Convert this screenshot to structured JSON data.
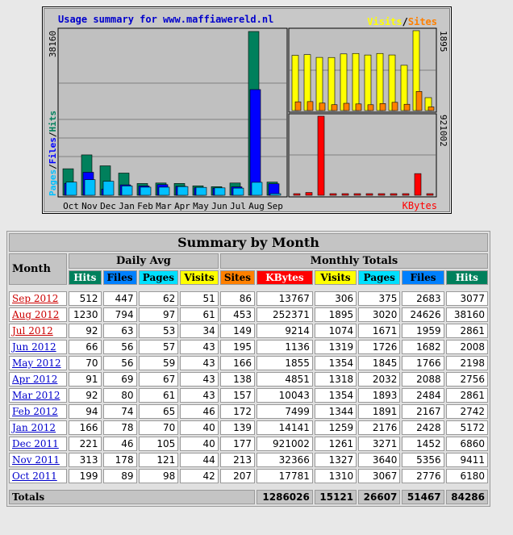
{
  "chart_data": {
    "type": "bar",
    "title": "Usage summary for www.maffiawereld.nl",
    "months": [
      "Oct",
      "Nov",
      "Dec",
      "Jan",
      "Feb",
      "Mar",
      "Apr",
      "May",
      "Jun",
      "Jul",
      "Aug",
      "Sep"
    ],
    "left_panel": {
      "max_label": "38160",
      "legend": [
        "Pages",
        "Files",
        "Hits"
      ],
      "legend_sep": "/",
      "colors": {
        "Hits": "#00805c",
        "Files": "#0000ff",
        "Pages": "#00c0ff"
      },
      "series": {
        "Hits": [
          6180,
          9411,
          6860,
          5172,
          2742,
          2861,
          2756,
          2198,
          2008,
          2861,
          38160,
          3077
        ],
        "Files": [
          2776,
          5356,
          1452,
          2428,
          2167,
          2484,
          2088,
          1766,
          1682,
          1959,
          24626,
          2683
        ],
        "Pages": [
          3067,
          3640,
          3271,
          2176,
          1891,
          1893,
          2032,
          1845,
          1726,
          1671,
          3020,
          375
        ]
      }
    },
    "visits_panel": {
      "max_label": "1895",
      "legend": [
        "Visits",
        "Sites"
      ],
      "legend_sep": "/",
      "colors": {
        "Visits": "#ffff00",
        "Sites": "#ff8000"
      },
      "series": {
        "Visits": [
          1310,
          1327,
          1261,
          1259,
          1344,
          1354,
          1318,
          1354,
          1319,
          1074,
          1895,
          306
        ],
        "Sites": [
          207,
          213,
          177,
          139,
          172,
          157,
          138,
          166,
          195,
          149,
          453,
          86
        ]
      }
    },
    "kbytes_panel": {
      "max_label": "921002",
      "legend": "KBytes",
      "color": "#ff0000",
      "series": {
        "KBytes": [
          17781,
          32366,
          921002,
          14141,
          7499,
          10043,
          4851,
          1855,
          1136,
          9214,
          252371,
          13767
        ]
      }
    }
  },
  "table": {
    "title": "Summary by Month",
    "month_header": "Month",
    "daily_avg_header": "Daily Avg",
    "monthly_totals_header": "Monthly Totals",
    "columns": [
      {
        "label": "Hits",
        "bg": "#00805c"
      },
      {
        "label": "Files",
        "bg": "#0080ff"
      },
      {
        "label": "Pages",
        "bg": "#00e0ff"
      },
      {
        "label": "Visits",
        "bg": "#ffff00"
      },
      {
        "label": "Sites",
        "bg": "#ff8000"
      },
      {
        "label": "KBytes",
        "bg": "#ff0000"
      },
      {
        "label": "Visits",
        "bg": "#ffff00"
      },
      {
        "label": "Pages",
        "bg": "#00e0ff"
      },
      {
        "label": "Files",
        "bg": "#0080ff"
      },
      {
        "label": "Hits",
        "bg": "#00805c"
      }
    ],
    "rows": [
      {
        "month": "Sep 2012",
        "link_color": "red",
        "values": [
          "512",
          "447",
          "62",
          "51",
          "86",
          "13767",
          "306",
          "375",
          "2683",
          "3077"
        ]
      },
      {
        "month": "Aug 2012",
        "link_color": "red",
        "values": [
          "1230",
          "794",
          "97",
          "61",
          "453",
          "252371",
          "1895",
          "3020",
          "24626",
          "38160"
        ]
      },
      {
        "month": "Jul 2012",
        "link_color": "red",
        "values": [
          "92",
          "63",
          "53",
          "34",
          "149",
          "9214",
          "1074",
          "1671",
          "1959",
          "2861"
        ]
      },
      {
        "month": "Jun 2012",
        "link_color": "blue",
        "values": [
          "66",
          "56",
          "57",
          "43",
          "195",
          "1136",
          "1319",
          "1726",
          "1682",
          "2008"
        ]
      },
      {
        "month": "May 2012",
        "link_color": "blue",
        "values": [
          "70",
          "56",
          "59",
          "43",
          "166",
          "1855",
          "1354",
          "1845",
          "1766",
          "2198"
        ]
      },
      {
        "month": "Apr 2012",
        "link_color": "blue",
        "values": [
          "91",
          "69",
          "67",
          "43",
          "138",
          "4851",
          "1318",
          "2032",
          "2088",
          "2756"
        ]
      },
      {
        "month": "Mar 2012",
        "link_color": "blue",
        "values": [
          "92",
          "80",
          "61",
          "43",
          "157",
          "10043",
          "1354",
          "1893",
          "2484",
          "2861"
        ]
      },
      {
        "month": "Feb 2012",
        "link_color": "blue",
        "values": [
          "94",
          "74",
          "65",
          "46",
          "172",
          "7499",
          "1344",
          "1891",
          "2167",
          "2742"
        ]
      },
      {
        "month": "Jan 2012",
        "link_color": "blue",
        "values": [
          "166",
          "78",
          "70",
          "40",
          "139",
          "14141",
          "1259",
          "2176",
          "2428",
          "5172"
        ]
      },
      {
        "month": "Dec 2011",
        "link_color": "blue",
        "values": [
          "221",
          "46",
          "105",
          "40",
          "177",
          "921002",
          "1261",
          "3271",
          "1452",
          "6860"
        ]
      },
      {
        "month": "Nov 2011",
        "link_color": "blue",
        "values": [
          "313",
          "178",
          "121",
          "44",
          "213",
          "32366",
          "1327",
          "3640",
          "5356",
          "9411"
        ]
      },
      {
        "month": "Oct 2011",
        "link_color": "blue",
        "values": [
          "199",
          "89",
          "98",
          "42",
          "207",
          "17781",
          "1310",
          "3067",
          "2776",
          "6180"
        ]
      }
    ],
    "totals": {
      "label": "Totals",
      "kbytes": "1286026",
      "visits": "15121",
      "pages": "26607",
      "files": "51467",
      "hits": "84286"
    }
  }
}
